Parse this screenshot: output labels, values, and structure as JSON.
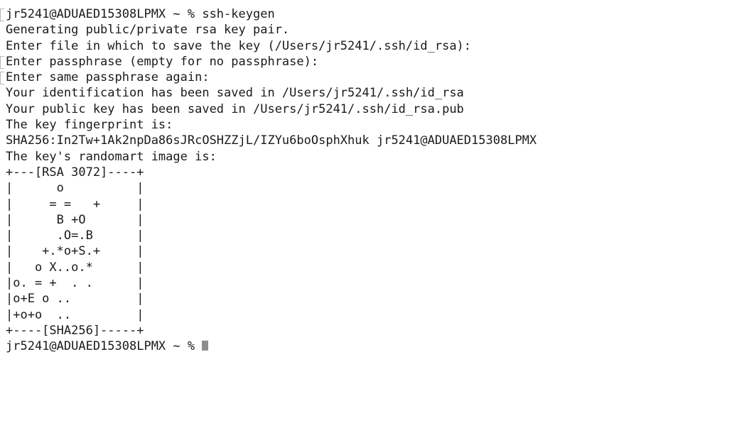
{
  "terminal": {
    "lines": [
      {
        "text": "jr5241@ADUAED15308LPMX ~ % ssh-keygen",
        "mark": true
      },
      {
        "text": "Generating public/private rsa key pair.",
        "mark": false
      },
      {
        "text": "Enter file in which to save the key (/Users/jr5241/.ssh/id_rsa):",
        "mark": false
      },
      {
        "text": "Enter passphrase (empty for no passphrase):",
        "mark": true
      },
      {
        "text": "Enter same passphrase again:",
        "mark": true
      },
      {
        "text": "Your identification has been saved in /Users/jr5241/.ssh/id_rsa",
        "mark": false
      },
      {
        "text": "Your public key has been saved in /Users/jr5241/.ssh/id_rsa.pub",
        "mark": false
      },
      {
        "text": "The key fingerprint is:",
        "mark": false
      },
      {
        "text": "SHA256:In2Tw+1Ak2npDa86sJRcOSHZZjL/IZYu6boOsphXhuk jr5241@ADUAED15308LPMX",
        "mark": false
      },
      {
        "text": "The key's randomart image is:",
        "mark": false
      },
      {
        "text": "+---[RSA 3072]----+",
        "mark": false
      },
      {
        "text": "|      o          |",
        "mark": false
      },
      {
        "text": "|     = =   +     |",
        "mark": false
      },
      {
        "text": "|      B +O       |",
        "mark": false
      },
      {
        "text": "|      .O=.B      |",
        "mark": false
      },
      {
        "text": "|    +.*o+S.+     |",
        "mark": false
      },
      {
        "text": "|   o X..o.*      |",
        "mark": false
      },
      {
        "text": "|o. = +  . .      |",
        "mark": false
      },
      {
        "text": "|o+E o ..         |",
        "mark": false
      },
      {
        "text": "|+o+o  ..         |",
        "mark": false
      },
      {
        "text": "+----[SHA256]-----+",
        "mark": false
      }
    ],
    "prompt": "jr5241@ADUAED15308LPMX ~ % "
  }
}
